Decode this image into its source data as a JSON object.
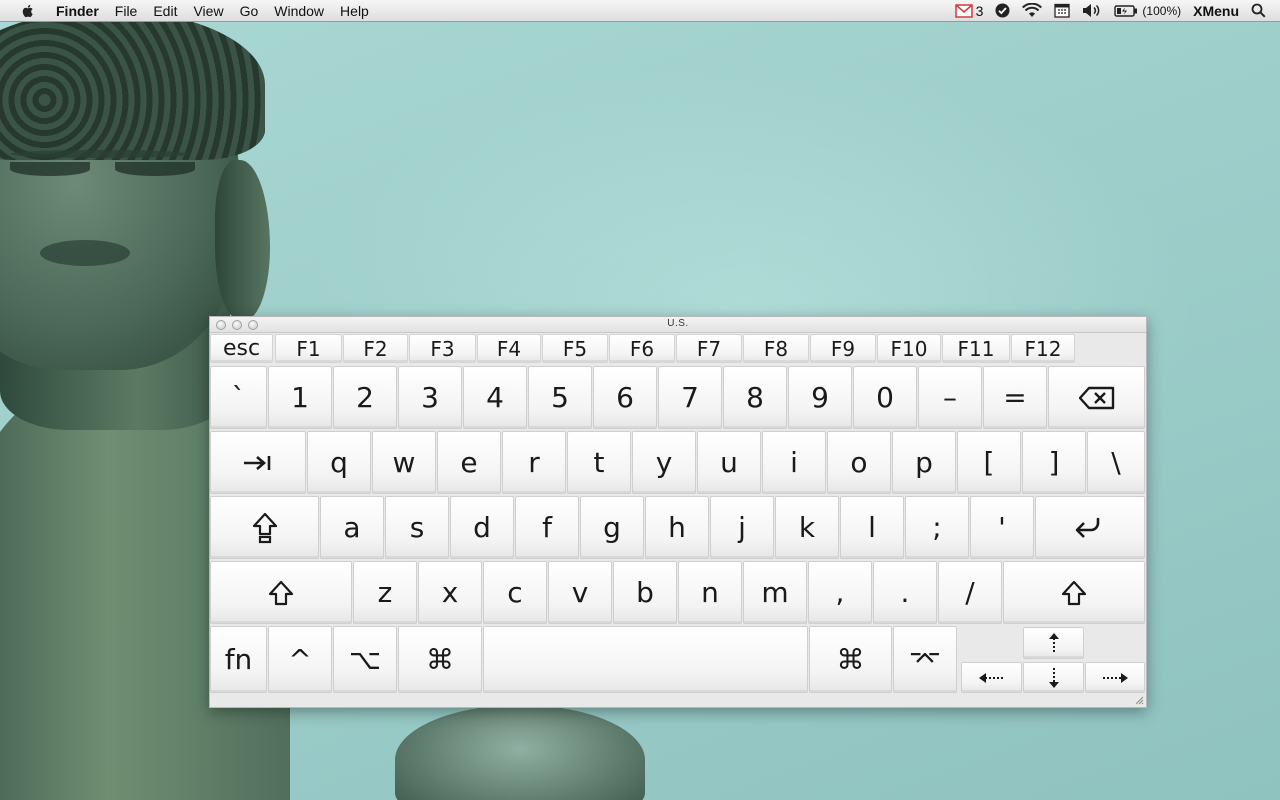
{
  "menubar": {
    "app_name": "Finder",
    "menus": [
      "File",
      "Edit",
      "View",
      "Go",
      "Window",
      "Help"
    ],
    "status": {
      "mail_count": "3",
      "battery_percent": "(100%)",
      "xmenu_label": "XMenu",
      "icons": [
        "mail-icon",
        "checkmark-circle-icon",
        "wifi-icon",
        "calendar-icon",
        "volume-icon",
        "battery-icon",
        "spotlight-search-icon"
      ]
    }
  },
  "keyboard_viewer": {
    "title": "U.S.",
    "function_row": [
      "esc",
      "F1",
      "F2",
      "F3",
      "F4",
      "F5",
      "F6",
      "F7",
      "F8",
      "F9",
      "F10",
      "F11",
      "F12"
    ],
    "number_row": [
      "`",
      "1",
      "2",
      "3",
      "4",
      "5",
      "6",
      "7",
      "8",
      "9",
      "0",
      "–",
      "="
    ],
    "top_row": [
      "q",
      "w",
      "e",
      "r",
      "t",
      "y",
      "u",
      "i",
      "o",
      "p",
      "[",
      "]",
      "\\"
    ],
    "home_row": [
      "a",
      "s",
      "d",
      "f",
      "g",
      "h",
      "j",
      "k",
      "l",
      ";",
      "'"
    ],
    "bottom_row": [
      "z",
      "x",
      "c",
      "v",
      "b",
      "n",
      "m",
      ",",
      ".",
      "/"
    ],
    "modifiers": {
      "fn": "fn",
      "control": "^",
      "option": "⌥",
      "command_left": "⌘",
      "command_right": "⌘",
      "right_option": "⌤"
    },
    "icons": {
      "delete": "delete-icon",
      "tab": "tab-icon",
      "caps_lock": "caps-lock-icon",
      "return": "return-icon",
      "shift_left": "shift-icon",
      "shift_right": "shift-icon",
      "arrow_up": "arrow-up-icon",
      "arrow_left": "arrow-left-icon",
      "arrow_down": "arrow-down-icon",
      "arrow_right": "arrow-right-icon"
    }
  }
}
